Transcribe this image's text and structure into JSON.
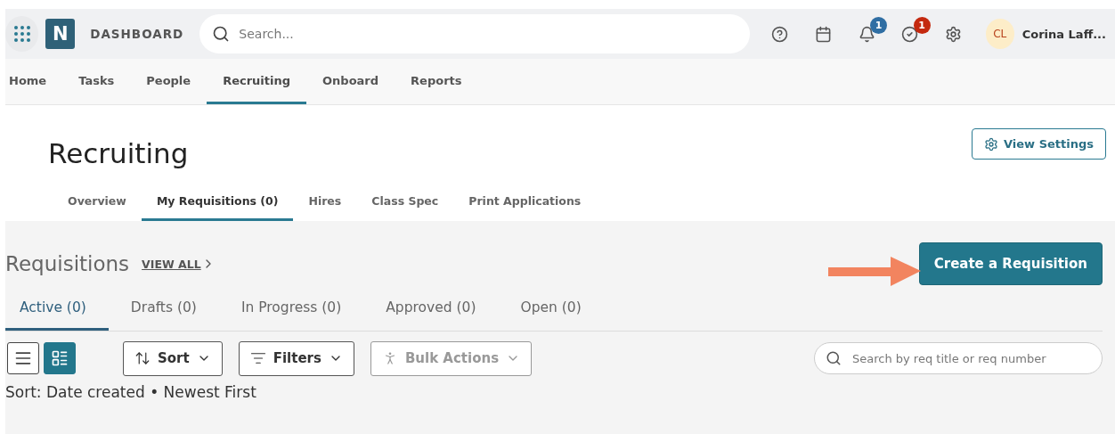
{
  "header": {
    "logo": "N",
    "title": "DASHBOARD",
    "search": {
      "placeholder": "Search..."
    },
    "icons": [
      {
        "kind": "help"
      },
      {
        "kind": "calendar"
      },
      {
        "kind": "bell",
        "badge": "1",
        "color": "#2f6ea3"
      },
      {
        "kind": "check",
        "badge": "1",
        "color": "#c4290f"
      },
      {
        "kind": "settings"
      }
    ],
    "user": {
      "initials": "CL",
      "name": "Corina Laff..."
    }
  },
  "nav": [
    {
      "label": "Home",
      "selected": false
    },
    {
      "label": "Tasks",
      "selected": false
    },
    {
      "label": "People",
      "selected": false
    },
    {
      "label": "Recruiting",
      "selected": true
    },
    {
      "label": "Onboard",
      "selected": false
    },
    {
      "label": "Reports",
      "selected": false
    }
  ],
  "page": {
    "title": "Recruiting",
    "view_settings": "View Settings",
    "tabs": [
      {
        "label": "Overview",
        "selected": false
      },
      {
        "label": "My Requisitions (0)",
        "selected": true
      },
      {
        "label": "Hires",
        "selected": false
      },
      {
        "label": "Class Spec",
        "selected": false
      },
      {
        "label": "Print Applications",
        "selected": false
      }
    ]
  },
  "requisitions": {
    "title": "Requisitions",
    "view_all": "VIEW ALL",
    "create": "Create a Requisition",
    "tabs": [
      {
        "label": "Active (0)",
        "selected": true
      },
      {
        "label": "Drafts (0)",
        "selected": false
      },
      {
        "label": "In Progress (0)",
        "selected": false
      },
      {
        "label": "Approved (0)",
        "selected": false
      },
      {
        "label": "Open (0)",
        "selected": false
      }
    ],
    "views": [
      {
        "kind": "list",
        "selected": false
      },
      {
        "kind": "cards",
        "selected": true
      }
    ],
    "tools": [
      {
        "kind": "sort",
        "label": "Sort",
        "disabled": false
      },
      {
        "kind": "filters",
        "label": "Filters",
        "disabled": false
      },
      {
        "kind": "bulk",
        "label": "Bulk Actions",
        "disabled": true
      }
    ],
    "search": {
      "placeholder": "Search by req title or req number"
    },
    "sort_note": "Sort: Date created • Newest First"
  }
}
